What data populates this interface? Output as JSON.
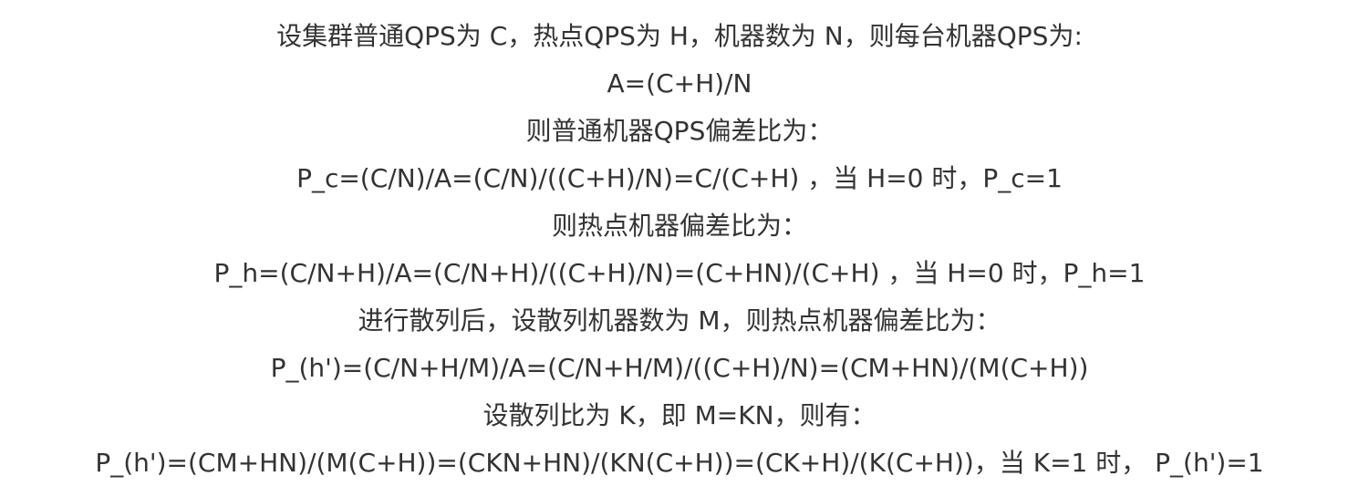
{
  "lines": [
    "设集群普通QPS为 C，热点QPS为 H，机器数为 N，则每台机器QPS为:",
    "A=(C+H)/N",
    "则普通机器QPS偏差比为：",
    "P_c=(C/N)/A=(C/N)/((C+H)/N)=C/(C+H) ，当 H=0 时，P_c=1",
    "则热点机器偏差比为：",
    "P_h=(C/N+H)/A=(C/N+H)/((C+H)/N)=(C+HN)/(C+H) ，当 H=0 时，P_h=1",
    "进行散列后，设散列机器数为 M，则热点机器偏差比为：",
    "P_(h')=(C/N+H/M)/A=(C/N+H/M)/((C+H)/N)=(CM+HN)/(M(C+H))",
    "设散列比为 K，即 M=KN，则有：",
    "P_(h')=(CM+HN)/(M(C+H))=(CKN+HN)/(KN(C+H))=(CK+H)/(K(C+H))，当 K=1 时， P_(h')=1"
  ]
}
